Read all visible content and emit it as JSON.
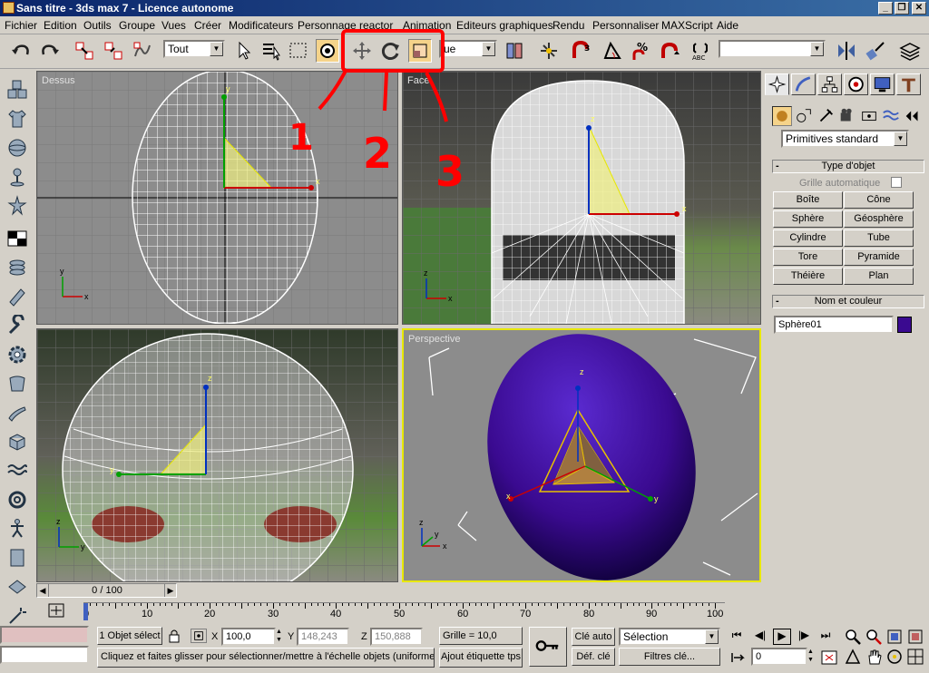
{
  "titlebar": {
    "title": "Sans titre - 3ds max 7 - Licence autonome",
    "minimize": "_",
    "restore": "❐",
    "close": "✕"
  },
  "menu": [
    "Fichier",
    "Edition",
    "Outils",
    "Groupe",
    "Vues",
    "Créer",
    "Modificateurs",
    "Personnage",
    "reactor",
    "Animation",
    "Editeurs graphiques",
    "Rendu",
    "Personnaliser",
    "MAXScript",
    "Aide"
  ],
  "toolbar": {
    "selection_filter": "Tout",
    "reference_coord": "ue",
    "named_selection": ""
  },
  "annotations": {
    "one": "1",
    "two": "2",
    "three": "3",
    "color": "#ff0000"
  },
  "viewports": {
    "top": "Dessus",
    "front": "Face",
    "left": "",
    "perspective": "Perspective",
    "active_border_color": "#e8e800"
  },
  "axes": {
    "x": "x",
    "y": "y",
    "z": "z"
  },
  "cmdpanel": {
    "category": "Primitives standard",
    "rollout1": "Type d'objet",
    "autogrid": "Grille automatique",
    "buttons": [
      "Boîte",
      "Cône",
      "Sphère",
      "Géosphère",
      "Cylindre",
      "Tube",
      "Tore",
      "Pyramide",
      "Théière",
      "Plan"
    ],
    "rollout2": "Nom et couleur",
    "object_name": "Sphère01",
    "object_color": "#3a0a90"
  },
  "timeline": {
    "slider": "0 / 100",
    "ticks": [
      "0",
      "10",
      "20",
      "30",
      "40",
      "50",
      "60",
      "70",
      "80",
      "90",
      "100"
    ]
  },
  "status": {
    "selection": "1 Objet sélect",
    "prompt": "Cliquez et faites glisser pour sélectionner/mettre à l'échelle objets (uniforme",
    "x_label": "X",
    "x_value": "100,0",
    "y_label": "Y",
    "y_value": "148,243",
    "z_label": "Z",
    "z_value": "150,888",
    "grid": "Grille = 10,0",
    "add_time_tag": "Ajout étiquette tps",
    "auto_key": "Clé auto",
    "set_key": "Déf. clé",
    "key_mode": "Sélection",
    "key_filters": "Filtres clé...",
    "frame": "0"
  }
}
